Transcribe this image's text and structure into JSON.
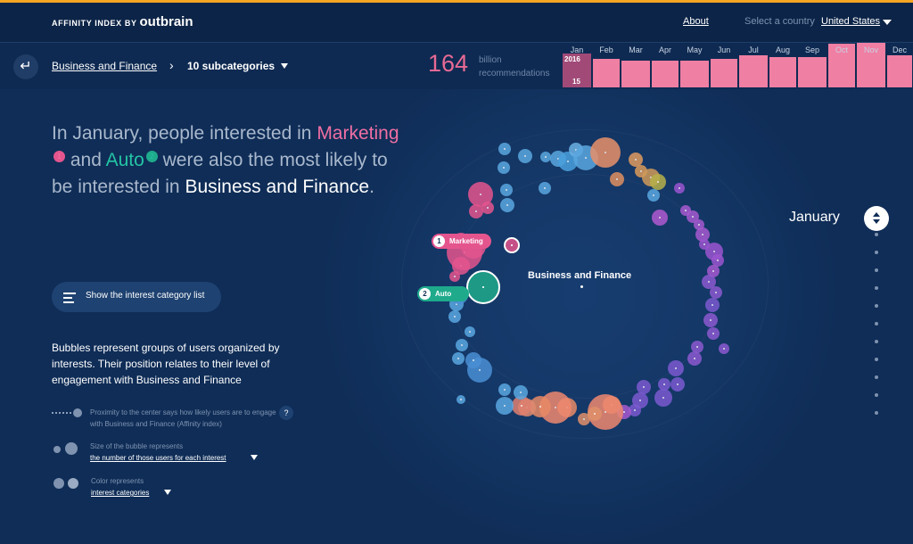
{
  "header": {
    "brand": "AFFINITY INDEX BY",
    "brand_logo": "outbrain",
    "about": "About",
    "select_country_label": "Select a country",
    "country": "United States"
  },
  "subbar": {
    "breadcrumb": "Business and Finance",
    "subcategories": "10 subcategories",
    "big_number": "164",
    "big_number_unit_line1": "billion",
    "big_number_unit_line2": "recommendations"
  },
  "timeline": {
    "year": "2016",
    "day": "15",
    "months": [
      {
        "label": "Jan",
        "level": 0.75,
        "active": true
      },
      {
        "label": "Feb",
        "level": 0.64
      },
      {
        "label": "Mar",
        "level": 0.6
      },
      {
        "label": "Apr",
        "level": 0.6
      },
      {
        "label": "May",
        "level": 0.6
      },
      {
        "label": "Jun",
        "level": 0.64
      },
      {
        "label": "Jul",
        "level": 0.72
      },
      {
        "label": "Aug",
        "level": 0.68
      },
      {
        "label": "Sep",
        "level": 0.68
      },
      {
        "label": "Oct",
        "level": 0.98
      },
      {
        "label": "Nov",
        "level": 1.0
      },
      {
        "label": "Dec",
        "level": 0.72
      }
    ]
  },
  "headline": {
    "p1": "In January, people interested in ",
    "cat1": "Marketing",
    "cat1_num": "1",
    "p2": " and ",
    "cat2": "Auto",
    "cat2_num": "2",
    "p3": " were also the most likely to be interested in ",
    "focus": "Business and Finance",
    "p4": "."
  },
  "list_button": "Show the interest category list",
  "description": "Bubbles represent groups of users organized by interests. Their position relates to their level of engagement with Business and Finance",
  "legend": {
    "proximity": "Proximity to the center says how likely users are to engage with Business and Finance (Affinity index)",
    "help": "?",
    "size_label": "Size of the bubble represents",
    "size_link": "the number of those users for each interest",
    "color_label": "Color represents",
    "color_link": "interest categories"
  },
  "chart": {
    "center_label": "Business and Finance",
    "callouts": [
      {
        "num": "1",
        "name": "Marketing",
        "color": "#e4558e"
      },
      {
        "num": "2",
        "name": "Auto",
        "color": "#1faa8c"
      }
    ],
    "month_name": "January"
  },
  "colors": {
    "background": "#0f2d57",
    "accent_pink": "#ef7fa3",
    "accent_teal": "#1faa8c",
    "top_stripe": "#f5a623"
  }
}
